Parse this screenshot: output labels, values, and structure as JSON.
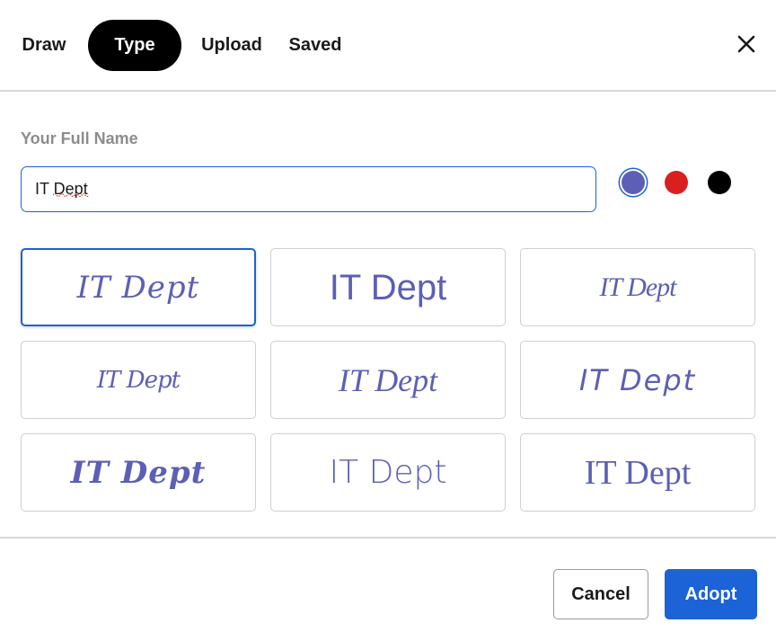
{
  "tabs": [
    {
      "label": "Draw"
    },
    {
      "label": "Type",
      "active": true
    },
    {
      "label": "Upload"
    },
    {
      "label": "Saved"
    }
  ],
  "close_icon": "close-icon",
  "name_field": {
    "label": "Your Full Name",
    "value": "IT Dept"
  },
  "colors": [
    {
      "name": "blue",
      "hex": "#5d5fb5",
      "selected": true
    },
    {
      "name": "red",
      "hex": "#d9201f",
      "selected": false
    },
    {
      "name": "black",
      "hex": "#000000",
      "selected": false
    }
  ],
  "signature_styles": [
    {
      "text": "IT Dept",
      "selected": true
    },
    {
      "text": "IT Dept"
    },
    {
      "text": "IT Dept"
    },
    {
      "text": "IT Dept"
    },
    {
      "text": "IT Dept"
    },
    {
      "text": "IT Dept"
    },
    {
      "text": "IT Dept"
    },
    {
      "text": "IT Dept"
    },
    {
      "text": "IT Dept"
    }
  ],
  "buttons": {
    "cancel": "Cancel",
    "adopt": "Adopt"
  }
}
